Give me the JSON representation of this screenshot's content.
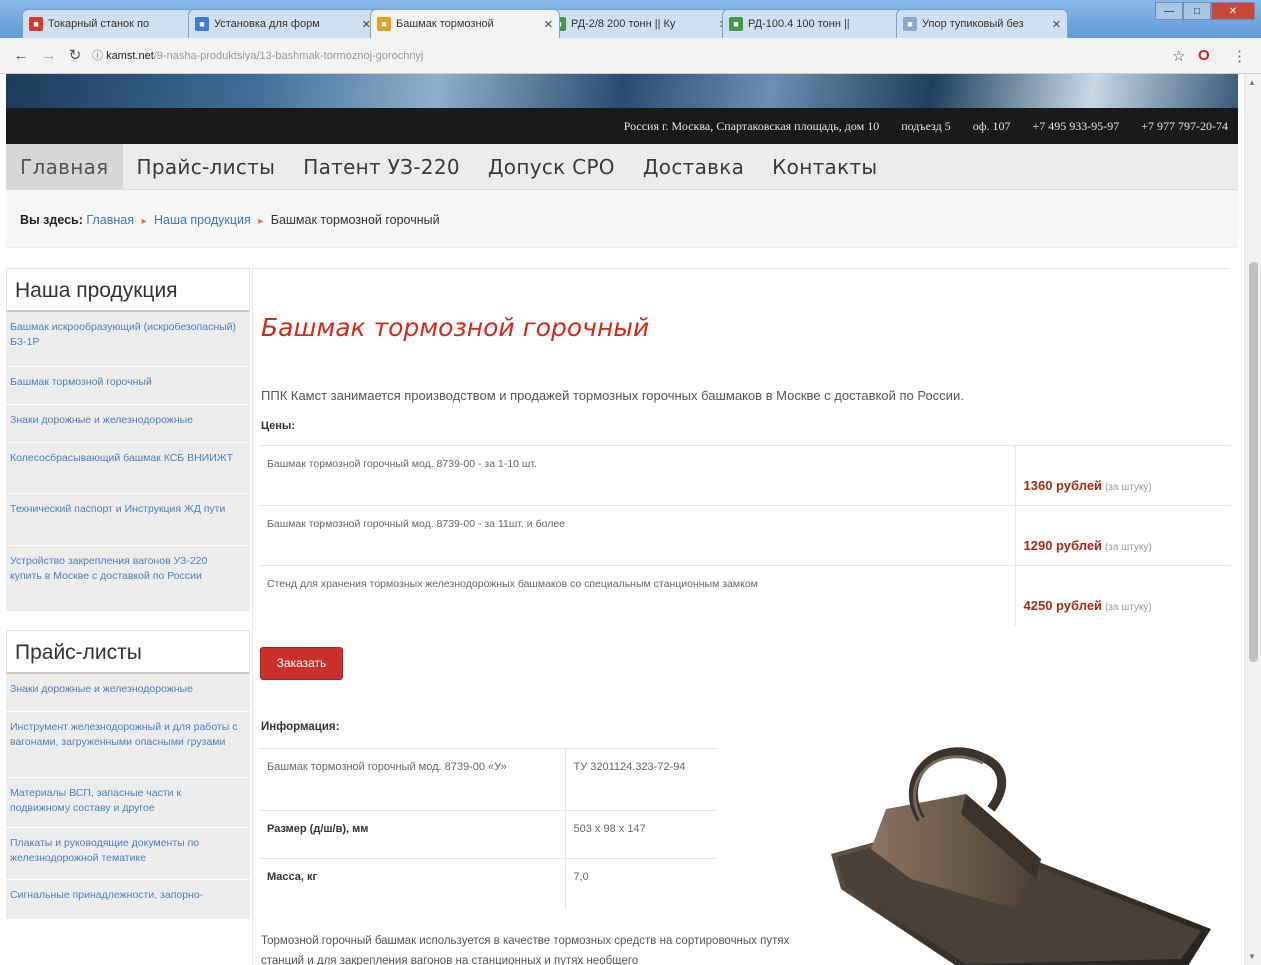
{
  "browser": {
    "tabs": [
      {
        "title": "Токарный станок по",
        "favicon_color": "#d9382c"
      },
      {
        "title": "Установка для форм",
        "favicon_color": "#3a7bd5"
      },
      {
        "title": "Башмак тормозной",
        "favicon_color": "#e0a020"
      },
      {
        "title": "РД-2/8 200 тонн || Ку",
        "favicon_color": "#3e9b48"
      },
      {
        "title": "РД-100.4 100 тонн ||",
        "favicon_color": "#3e9b48"
      },
      {
        "title": "Упор тупиковый без",
        "favicon_color": "#8aa7c9"
      }
    ],
    "window_buttons": [
      "—",
      "□",
      "✕"
    ],
    "url_host": "kamst.net",
    "url_path": "/9-nasha-produktsiya/13-bashmak-tormoznoj-gorochnyj"
  },
  "contact_bar": {
    "address": "Россия   г. Москва, Спартаковская площадь,  дом 10",
    "entrance": "подъезд 5",
    "office": "оф. 107",
    "phone1": "+7 495 933-95-97",
    "phone2": "+7 977 797-20-74"
  },
  "main_nav": {
    "items": [
      "Главная",
      "Прайс-листы",
      "Патент УЗ-220",
      "Допуск СРО",
      "Доставка",
      "Контакты"
    ]
  },
  "breadcrumbs": {
    "prefix": "Вы здесь:",
    "links": [
      "Главная",
      "Наша продукция"
    ],
    "current": "Башмак тормозной горочный"
  },
  "sidebar": {
    "products_title": "Наша продукция",
    "products": [
      "Башмак искрообразующий (искробезопасный) БЗ-1Р",
      "Башмак тормозной горочный",
      "Знаки дорожные и железнодорожные",
      "Колесосбрасывающий башмак КСБ ВНИИЖТ",
      "Технический паспорт и Инструкция ЖД пути",
      "Устройство закрепления вагонов УЗ-220 купить в Москве с доставкой по России"
    ],
    "prices_title": "Прайс-листы",
    "prices": [
      "Знаки дорожные и железнодорожные",
      "Инструмент железнодорожный и для работы с вагонами, загруженными опасными грузами",
      "Материалы ВСП, запасные части к подвижному составу и другое",
      "Плакаты и руководящие документы по железнодорожной тематике",
      "Сигнальные принадлежности, запорно-"
    ]
  },
  "article": {
    "title": "Башмак тормозной горочный",
    "intro": "ППК Камст занимается производством и продажей тормозных горочных башмаков в Москве с доставкой по России.",
    "prices_label": "Цены:",
    "price_rows": [
      {
        "desc": "Башмак тормозной горочный мод. 8739-00 - за 1-10 шт.",
        "amount": "1360 рублей",
        "unit": "(за штуку)"
      },
      {
        "desc": "Башмак тормозной горочный мод. 8739-00 - за 11шт. и более",
        "amount": "1290 рублей",
        "unit": "(за штуку)"
      },
      {
        "desc": "Стенд для хранения тормозных железнодорожных башмаков со специальным станционным замком",
        "amount": "4250 рублей",
        "unit": "(за штуку)"
      }
    ],
    "order_button": "Заказать",
    "info_label": "Информация:",
    "spec_rows": [
      {
        "key": "Башмак тормозной горочный мод. 8739-00 «У»",
        "value": "ТУ 3201124.323-72-94"
      },
      {
        "key": "Размер (д/ш/в), мм",
        "value": "503 х 98 х 147"
      },
      {
        "key": "Масса, кг",
        "value": "7,0"
      }
    ],
    "bottom_text": "Тормозной горочный башмак используется в качестве тормозных средств на сортировочных путях станций и для закрепления вагонов на станционных и путях необщего"
  },
  "colors": {
    "accent_red": "#d12a1d",
    "link_blue": "#3d76c2",
    "price_red": "#a32a14"
  }
}
